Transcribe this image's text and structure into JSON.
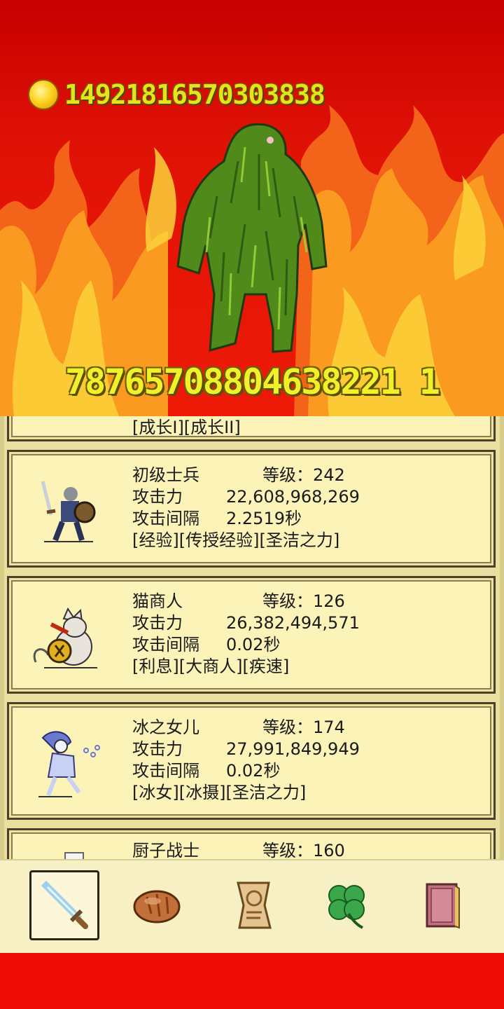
{
  "battle": {
    "gold": "14921816570303838",
    "boss_hp": "78765708804638221 1",
    "boss_name_icon": "moss-golem"
  },
  "heroes": [
    {
      "name": "",
      "level_text": "",
      "attack_label": "",
      "attack": "",
      "interval_label": "",
      "interval": "",
      "tags": "[成长I][成长II]"
    },
    {
      "name": "初级士兵",
      "level_text": "等级：242",
      "attack_label": "攻击力",
      "attack": "22,608,968,269",
      "interval_label": "攻击间隔",
      "interval": "2.2519秒",
      "tags": "[经验][传授经验][圣洁之力]",
      "icon": "soldier-icon"
    },
    {
      "name": "猫商人",
      "level_text": "等级：126",
      "attack_label": "攻击力",
      "attack": "26,382,494,571",
      "interval_label": "攻击间隔",
      "interval": "0.02秒",
      "tags": "[利息][大商人][疾速]",
      "icon": "cat-merchant-icon"
    },
    {
      "name": "冰之女儿",
      "level_text": "等级：174",
      "attack_label": "攻击力",
      "attack": "27,991,849,949",
      "interval_label": "攻击间隔",
      "interval": "0.02秒",
      "tags": "[冰女][冰摄][圣洁之力]",
      "icon": "ice-daughter-icon"
    },
    {
      "name": "厨子战士",
      "level_text": "等级：160",
      "icon": "chef-warrior-icon"
    }
  ],
  "nav": [
    {
      "icon": "sword-icon",
      "active": true
    },
    {
      "icon": "bread-icon",
      "active": false
    },
    {
      "icon": "scroll-icon",
      "active": false
    },
    {
      "icon": "clover-icon",
      "active": false
    },
    {
      "icon": "book-icon",
      "active": false
    }
  ],
  "colors": {
    "background_red": "#e8100a",
    "gold_text": "#e6e21e",
    "card_bg": "#fbf3b8"
  }
}
